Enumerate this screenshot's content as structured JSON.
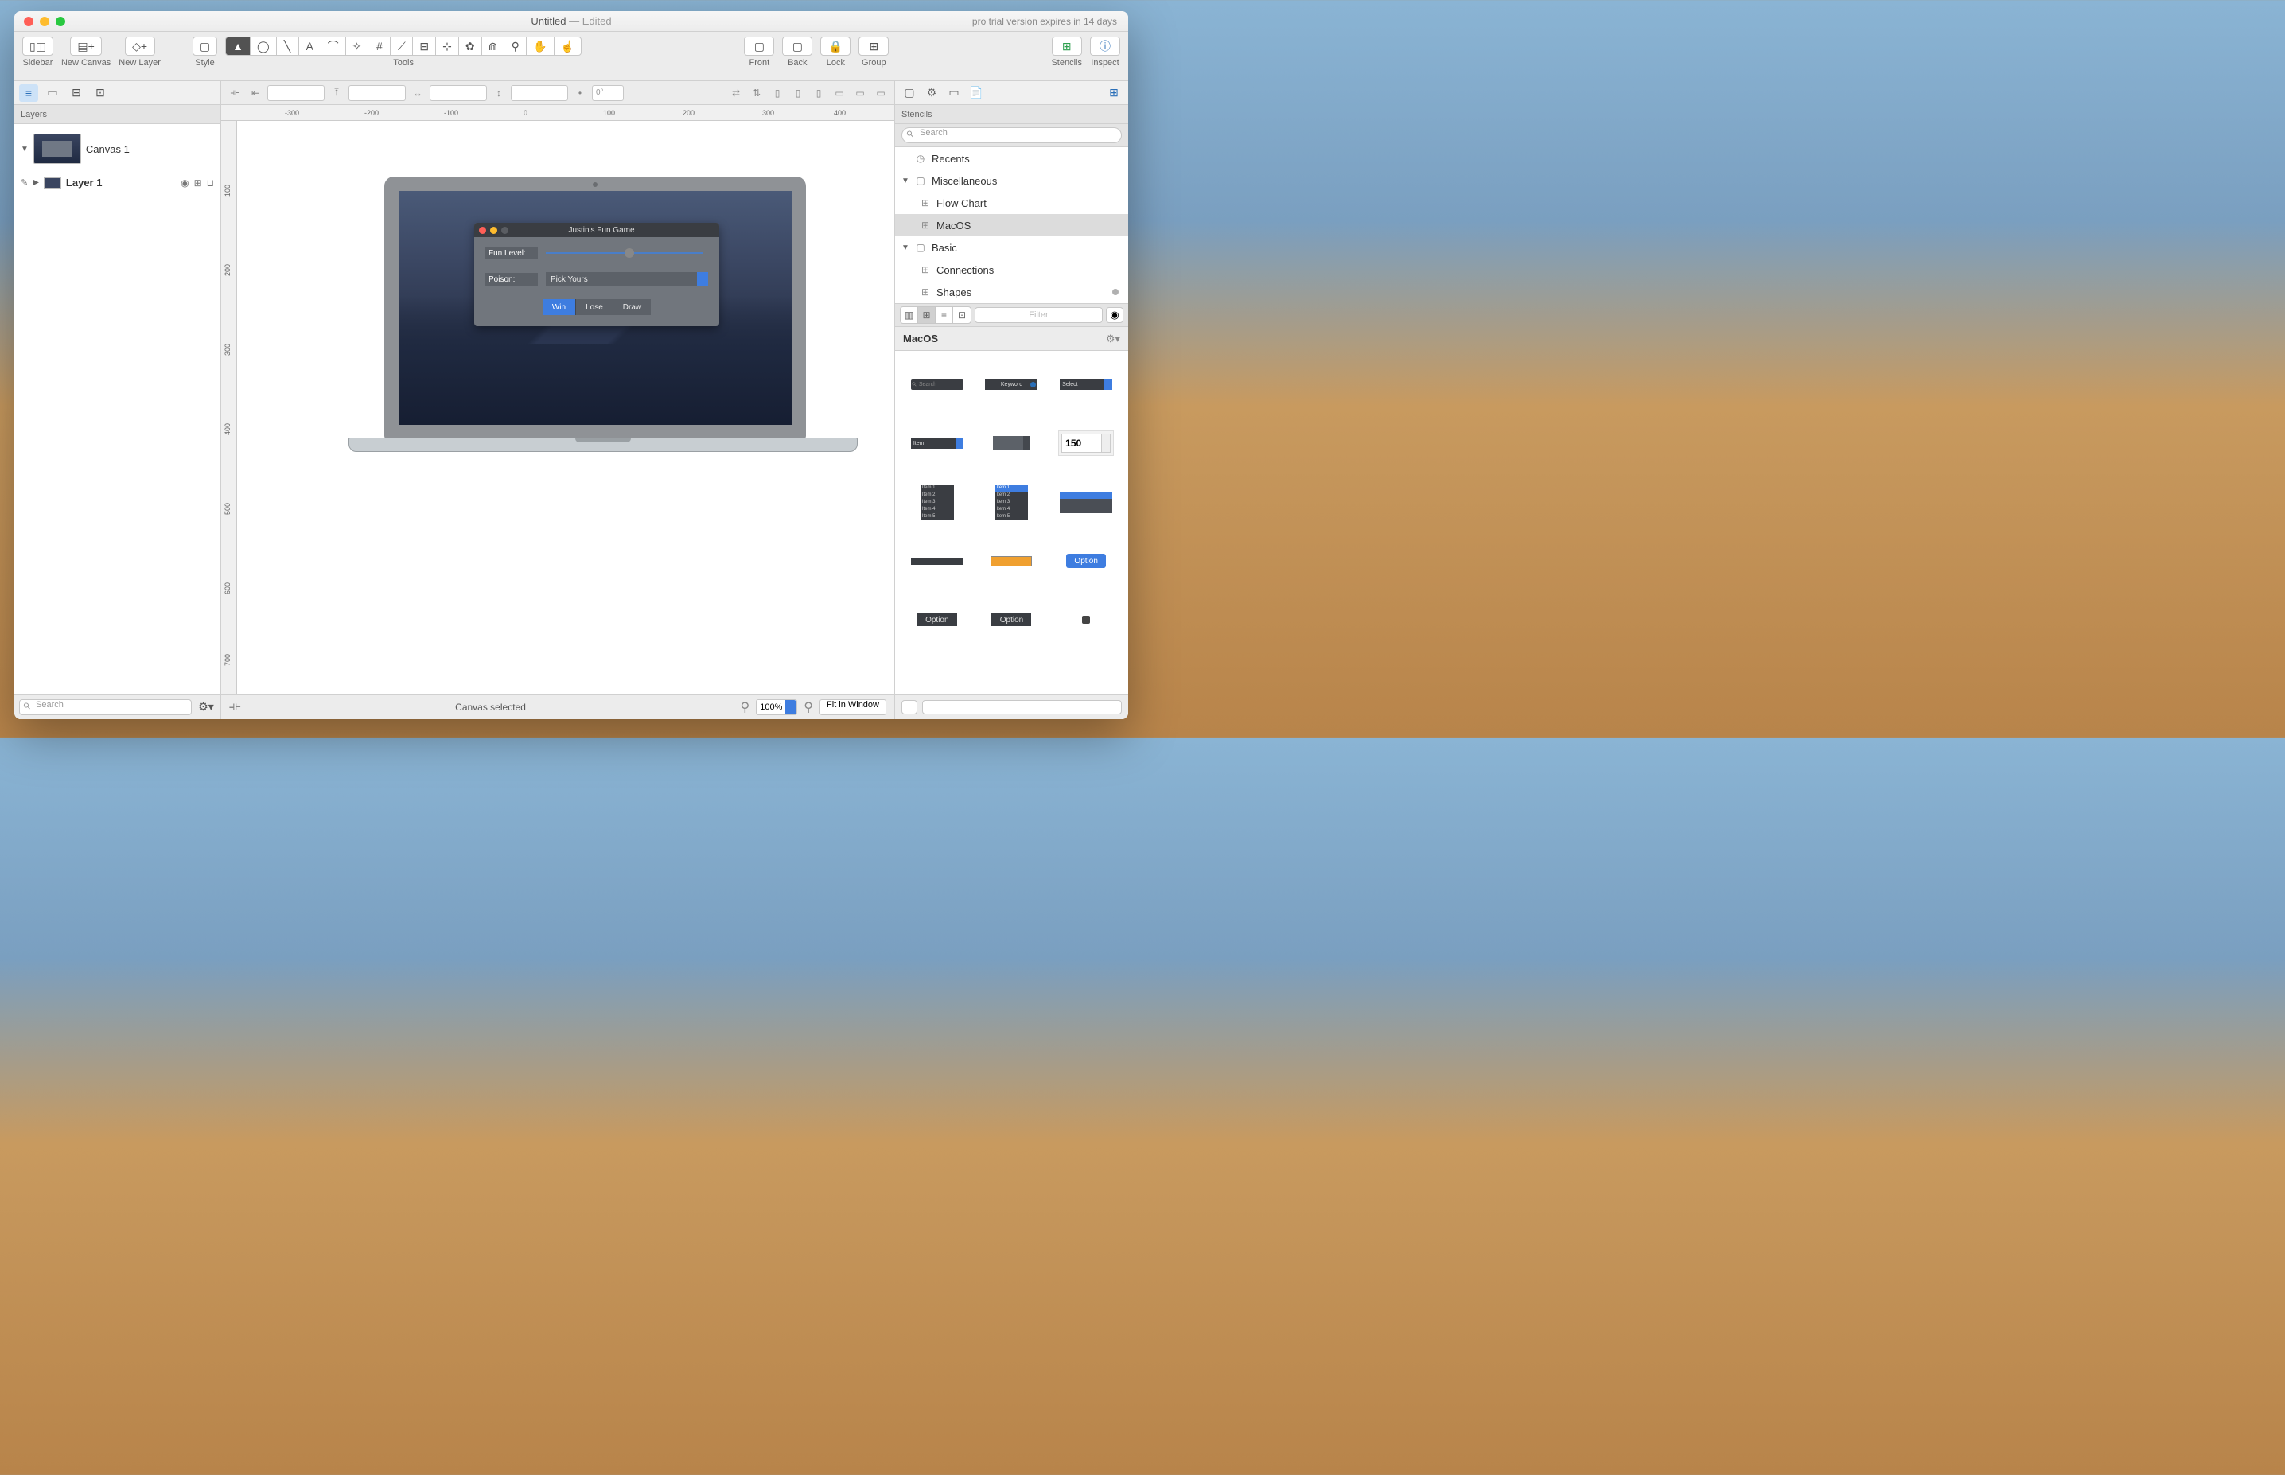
{
  "titlebar": {
    "title": "Untitled",
    "edited": " — Edited",
    "trial": "pro trial version expires in 14 days"
  },
  "toolbar": {
    "sidebar": "Sidebar",
    "newcanvas": "New Canvas",
    "newlayer": "New Layer",
    "style": "Style",
    "tools": "Tools",
    "front": "Front",
    "back": "Back",
    "lock": "Lock",
    "group": "Group",
    "stencils": "Stencils",
    "inspect": "Inspect"
  },
  "propbar": {
    "rotation": "0°"
  },
  "leftpanel": {
    "header": "Layers",
    "canvas_name": "Canvas 1",
    "layer_name": "Layer 1",
    "search_placeholder": "Search"
  },
  "ruler_h": [
    "-300",
    "-200",
    "-100",
    "0",
    "100",
    "200",
    "300",
    "400"
  ],
  "ruler_v": [
    "100",
    "200",
    "300",
    "400",
    "500",
    "600",
    "700"
  ],
  "canvas": {
    "game": {
      "title": "Justin's Fun Game",
      "fun_label": "Fun Level:",
      "poison_label": "Poison:",
      "poison_value": "Pick Yours",
      "seg": [
        "Win",
        "Lose",
        "Draw"
      ]
    },
    "status": "Canvas selected",
    "zoom": "100%",
    "fit": "Fit in Window"
  },
  "rightpanel": {
    "header": "Stencils",
    "search_placeholder": "Search",
    "tree": {
      "recents": "Recents",
      "misc": "Miscellaneous",
      "flowchart": "Flow Chart",
      "macos": "MacOS",
      "basic": "Basic",
      "connections": "Connections",
      "shapes": "Shapes"
    },
    "filter_placeholder": "Filter",
    "stencil_name": "MacOS",
    "cells": {
      "search": "Search",
      "keyword": "Keyword",
      "select": "Select",
      "item": "Item",
      "num": "150",
      "list": [
        "Item 1",
        "Item 2",
        "Item 3",
        "Item 4",
        "Item 5"
      ],
      "option": "Option"
    }
  }
}
